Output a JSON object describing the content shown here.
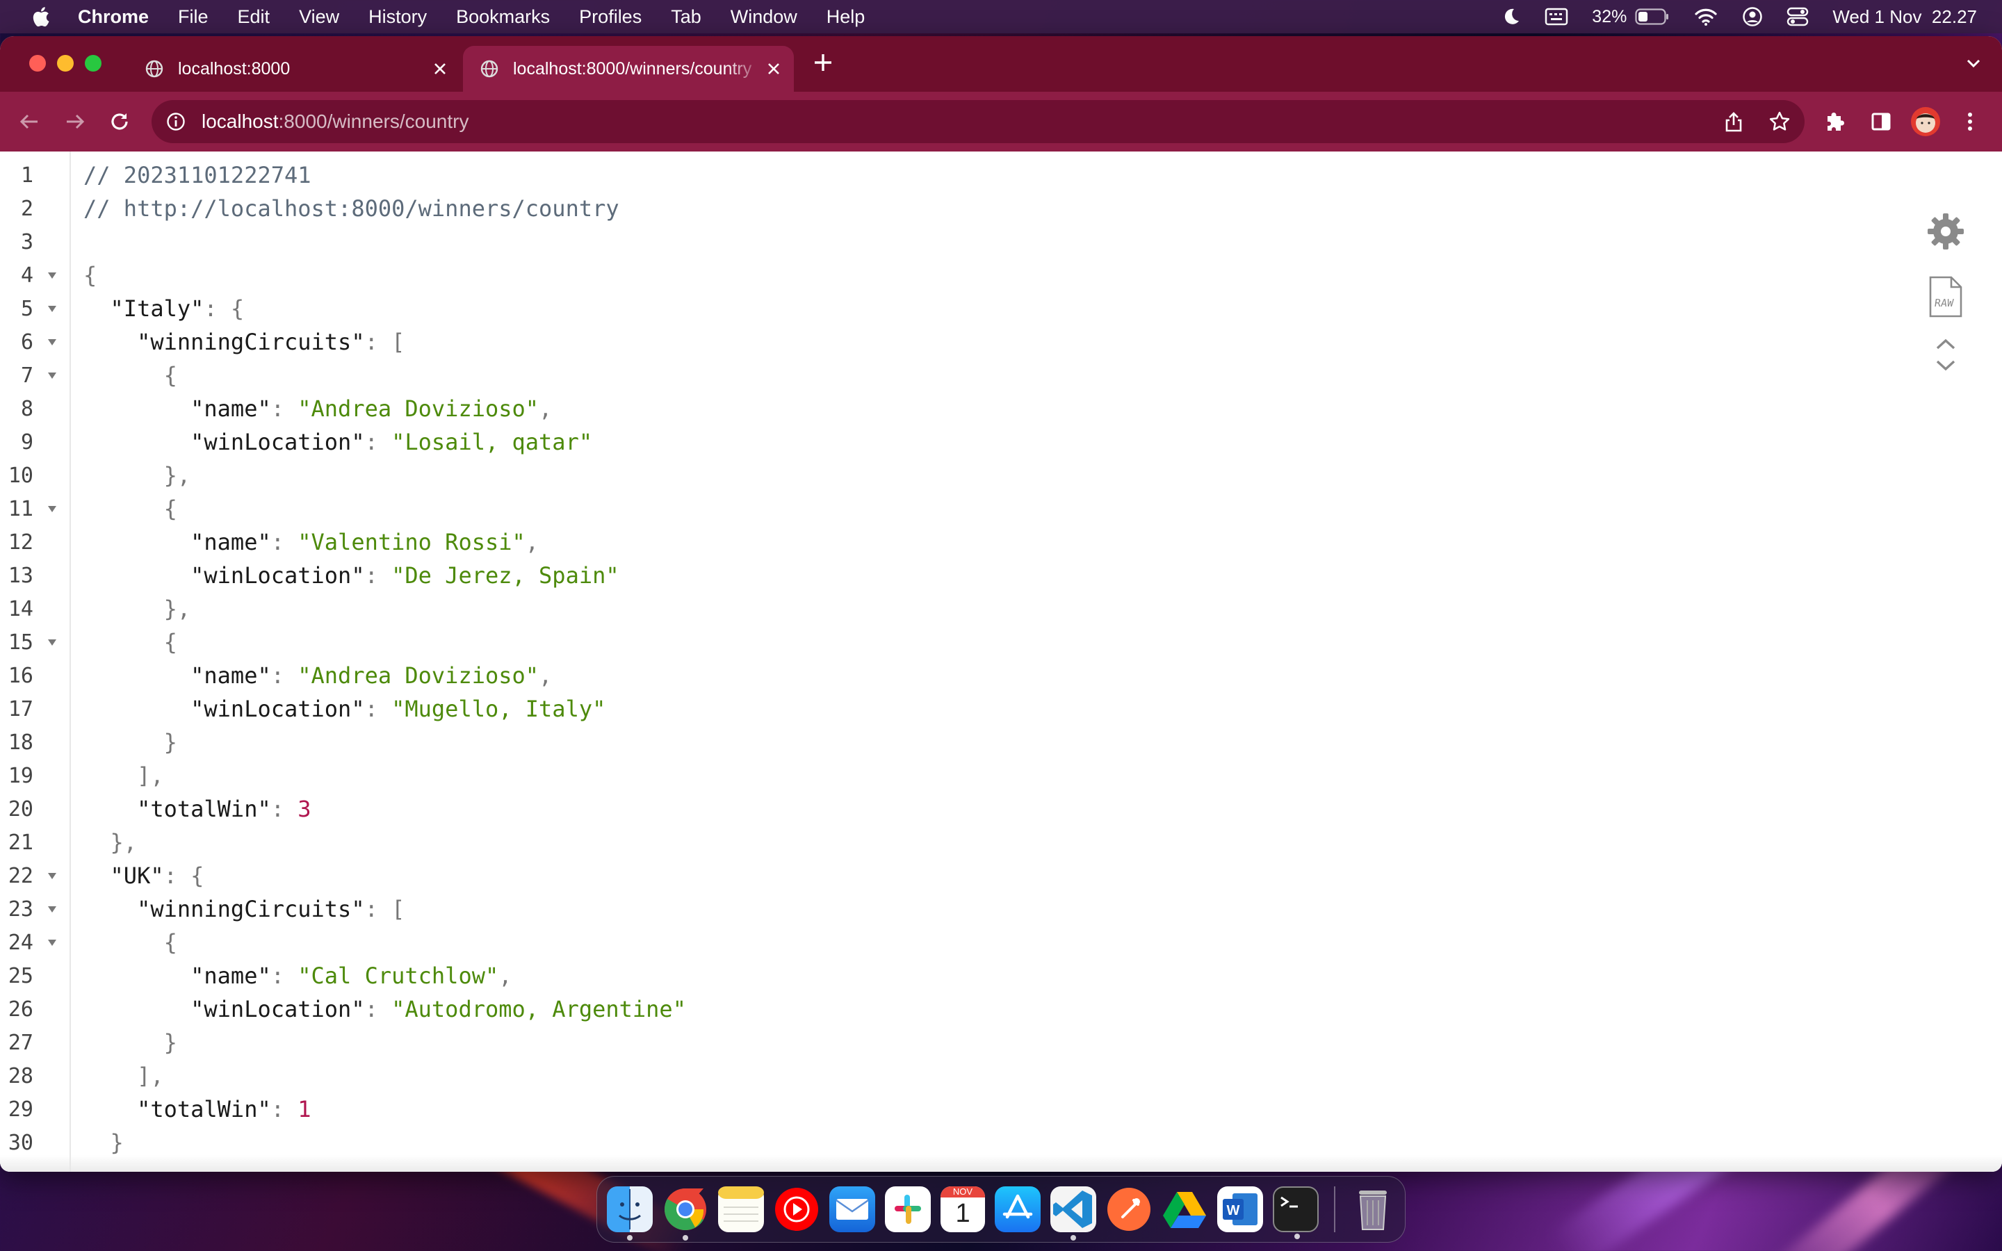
{
  "menubar": {
    "app": "Chrome",
    "items": [
      "File",
      "Edit",
      "View",
      "History",
      "Bookmarks",
      "Profiles",
      "Tab",
      "Window",
      "Help"
    ],
    "battery": "32%",
    "clock": "Wed 1 Nov  22.27"
  },
  "tabs": [
    {
      "title": "localhost:8000",
      "active": false
    },
    {
      "title": "localhost:8000/winners/country",
      "active": true
    }
  ],
  "omnibox": {
    "host": "localhost",
    "path": ":8000/winners/country"
  },
  "json_viewer": {
    "lines": [
      {
        "n": "1",
        "fold": false,
        "tokens": [
          {
            "t": "comment",
            "v": "// 20231101222741"
          }
        ]
      },
      {
        "n": "2",
        "fold": false,
        "tokens": [
          {
            "t": "comment",
            "v": "// http://localhost:8000/winners/country"
          }
        ]
      },
      {
        "n": "3",
        "fold": false,
        "tokens": []
      },
      {
        "n": "4",
        "fold": true,
        "tokens": [
          {
            "t": "punct",
            "v": "{"
          }
        ]
      },
      {
        "n": "5",
        "fold": true,
        "tokens": [
          {
            "t": "ws",
            "v": "  "
          },
          {
            "t": "key",
            "v": "\"Italy\""
          },
          {
            "t": "punct",
            "v": ": {"
          }
        ]
      },
      {
        "n": "6",
        "fold": true,
        "tokens": [
          {
            "t": "ws",
            "v": "    "
          },
          {
            "t": "key",
            "v": "\"winningCircuits\""
          },
          {
            "t": "punct",
            "v": ": ["
          }
        ]
      },
      {
        "n": "7",
        "fold": true,
        "tokens": [
          {
            "t": "ws",
            "v": "      "
          },
          {
            "t": "punct",
            "v": "{"
          }
        ]
      },
      {
        "n": "8",
        "fold": false,
        "tokens": [
          {
            "t": "ws",
            "v": "        "
          },
          {
            "t": "key",
            "v": "\"name\""
          },
          {
            "t": "punct",
            "v": ": "
          },
          {
            "t": "str",
            "v": "\"Andrea Dovizioso\""
          },
          {
            "t": "punct",
            "v": ","
          }
        ]
      },
      {
        "n": "9",
        "fold": false,
        "tokens": [
          {
            "t": "ws",
            "v": "        "
          },
          {
            "t": "key",
            "v": "\"winLocation\""
          },
          {
            "t": "punct",
            "v": ": "
          },
          {
            "t": "str",
            "v": "\"Losail, qatar\""
          }
        ]
      },
      {
        "n": "10",
        "fold": false,
        "tokens": [
          {
            "t": "ws",
            "v": "      "
          },
          {
            "t": "punct",
            "v": "},"
          }
        ]
      },
      {
        "n": "11",
        "fold": true,
        "tokens": [
          {
            "t": "ws",
            "v": "      "
          },
          {
            "t": "punct",
            "v": "{"
          }
        ]
      },
      {
        "n": "12",
        "fold": false,
        "tokens": [
          {
            "t": "ws",
            "v": "        "
          },
          {
            "t": "key",
            "v": "\"name\""
          },
          {
            "t": "punct",
            "v": ": "
          },
          {
            "t": "str",
            "v": "\"Valentino Rossi\""
          },
          {
            "t": "punct",
            "v": ","
          }
        ]
      },
      {
        "n": "13",
        "fold": false,
        "tokens": [
          {
            "t": "ws",
            "v": "        "
          },
          {
            "t": "key",
            "v": "\"winLocation\""
          },
          {
            "t": "punct",
            "v": ": "
          },
          {
            "t": "str",
            "v": "\"De Jerez, Spain\""
          }
        ]
      },
      {
        "n": "14",
        "fold": false,
        "tokens": [
          {
            "t": "ws",
            "v": "      "
          },
          {
            "t": "punct",
            "v": "},"
          }
        ]
      },
      {
        "n": "15",
        "fold": true,
        "tokens": [
          {
            "t": "ws",
            "v": "      "
          },
          {
            "t": "punct",
            "v": "{"
          }
        ]
      },
      {
        "n": "16",
        "fold": false,
        "tokens": [
          {
            "t": "ws",
            "v": "        "
          },
          {
            "t": "key",
            "v": "\"name\""
          },
          {
            "t": "punct",
            "v": ": "
          },
          {
            "t": "str",
            "v": "\"Andrea Dovizioso\""
          },
          {
            "t": "punct",
            "v": ","
          }
        ]
      },
      {
        "n": "17",
        "fold": false,
        "tokens": [
          {
            "t": "ws",
            "v": "        "
          },
          {
            "t": "key",
            "v": "\"winLocation\""
          },
          {
            "t": "punct",
            "v": ": "
          },
          {
            "t": "str",
            "v": "\"Mugello, Italy\""
          }
        ]
      },
      {
        "n": "18",
        "fold": false,
        "tokens": [
          {
            "t": "ws",
            "v": "      "
          },
          {
            "t": "punct",
            "v": "}"
          }
        ]
      },
      {
        "n": "19",
        "fold": false,
        "tokens": [
          {
            "t": "ws",
            "v": "    "
          },
          {
            "t": "punct",
            "v": "],"
          }
        ]
      },
      {
        "n": "20",
        "fold": false,
        "tokens": [
          {
            "t": "ws",
            "v": "    "
          },
          {
            "t": "key",
            "v": "\"totalWin\""
          },
          {
            "t": "punct",
            "v": ": "
          },
          {
            "t": "num",
            "v": "3"
          }
        ]
      },
      {
        "n": "21",
        "fold": false,
        "tokens": [
          {
            "t": "ws",
            "v": "  "
          },
          {
            "t": "punct",
            "v": "},"
          }
        ]
      },
      {
        "n": "22",
        "fold": true,
        "tokens": [
          {
            "t": "ws",
            "v": "  "
          },
          {
            "t": "key",
            "v": "\"UK\""
          },
          {
            "t": "punct",
            "v": ": {"
          }
        ]
      },
      {
        "n": "23",
        "fold": true,
        "tokens": [
          {
            "t": "ws",
            "v": "    "
          },
          {
            "t": "key",
            "v": "\"winningCircuits\""
          },
          {
            "t": "punct",
            "v": ": ["
          }
        ]
      },
      {
        "n": "24",
        "fold": true,
        "tokens": [
          {
            "t": "ws",
            "v": "      "
          },
          {
            "t": "punct",
            "v": "{"
          }
        ]
      },
      {
        "n": "25",
        "fold": false,
        "tokens": [
          {
            "t": "ws",
            "v": "        "
          },
          {
            "t": "key",
            "v": "\"name\""
          },
          {
            "t": "punct",
            "v": ": "
          },
          {
            "t": "str",
            "v": "\"Cal Crutchlow\""
          },
          {
            "t": "punct",
            "v": ","
          }
        ]
      },
      {
        "n": "26",
        "fold": false,
        "tokens": [
          {
            "t": "ws",
            "v": "        "
          },
          {
            "t": "key",
            "v": "\"winLocation\""
          },
          {
            "t": "punct",
            "v": ": "
          },
          {
            "t": "str",
            "v": "\"Autodromo, Argentine\""
          }
        ]
      },
      {
        "n": "27",
        "fold": false,
        "tokens": [
          {
            "t": "ws",
            "v": "      "
          },
          {
            "t": "punct",
            "v": "}"
          }
        ]
      },
      {
        "n": "28",
        "fold": false,
        "tokens": [
          {
            "t": "ws",
            "v": "    "
          },
          {
            "t": "punct",
            "v": "],"
          }
        ]
      },
      {
        "n": "29",
        "fold": false,
        "tokens": [
          {
            "t": "ws",
            "v": "    "
          },
          {
            "t": "key",
            "v": "\"totalWin\""
          },
          {
            "t": "punct",
            "v": ": "
          },
          {
            "t": "num",
            "v": "1"
          }
        ]
      },
      {
        "n": "30",
        "fold": false,
        "tokens": [
          {
            "t": "ws",
            "v": "  "
          },
          {
            "t": "punct",
            "v": "}"
          }
        ]
      }
    ]
  },
  "viewer_tools": {
    "raw_label": "RAW"
  },
  "dock": {
    "items": [
      {
        "name": "finder",
        "running": true
      },
      {
        "name": "chrome",
        "running": true
      },
      {
        "name": "notes",
        "running": false
      },
      {
        "name": "youtube-music",
        "running": false
      },
      {
        "name": "mail",
        "running": false
      },
      {
        "name": "slack",
        "running": false
      },
      {
        "name": "calendar",
        "running": false,
        "month": "NOV",
        "day": "1"
      },
      {
        "name": "app-store",
        "running": false
      },
      {
        "name": "vscode",
        "running": true
      },
      {
        "name": "postman",
        "running": false
      },
      {
        "name": "google-drive",
        "running": false
      },
      {
        "name": "word",
        "running": false
      },
      {
        "name": "terminal",
        "running": true
      }
    ]
  },
  "colors": {
    "tabstrip": "#6e0e2c",
    "toolbar": "#8e1d45",
    "json_string": "#4d8a0b",
    "json_number": "#b0154f"
  }
}
